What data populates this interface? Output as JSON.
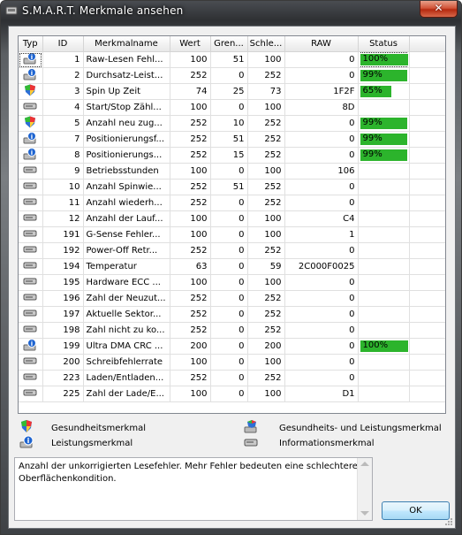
{
  "window": {
    "title": "S.M.A.R.T. Merkmale ansehen",
    "close_symbol": "✕"
  },
  "columns": [
    "Typ",
    "ID",
    "Merkmalname",
    "Wert",
    "Gren...",
    "Schle...",
    "RAW",
    "Status"
  ],
  "rows": [
    {
      "type": "performance",
      "id": "1",
      "name": "Raw-Lesen Fehl...",
      "wert": "100",
      "grenz": "51",
      "schlecht": "100",
      "raw": "0",
      "status": "100%",
      "pct": 100
    },
    {
      "type": "performance",
      "id": "2",
      "name": "Durchsatz-Leist...",
      "wert": "252",
      "grenz": "0",
      "schlecht": "252",
      "raw": "0",
      "status": "99%",
      "pct": 99
    },
    {
      "type": "health",
      "id": "3",
      "name": "Spin Up Zeit",
      "wert": "74",
      "grenz": "25",
      "schlecht": "73",
      "raw": "1F2F",
      "status": "65%",
      "pct": 65
    },
    {
      "type": "info",
      "id": "4",
      "name": "Start/Stop Zähl...",
      "wert": "100",
      "grenz": "0",
      "schlecht": "100",
      "raw": "8D",
      "status": "",
      "pct": 0
    },
    {
      "type": "health",
      "id": "5",
      "name": "Anzahl neu zug...",
      "wert": "252",
      "grenz": "10",
      "schlecht": "252",
      "raw": "0",
      "status": "99%",
      "pct": 99
    },
    {
      "type": "performance",
      "id": "7",
      "name": "Positionierungsf...",
      "wert": "252",
      "grenz": "51",
      "schlecht": "252",
      "raw": "0",
      "status": "99%",
      "pct": 99
    },
    {
      "type": "performance",
      "id": "8",
      "name": "Positionierungs...",
      "wert": "252",
      "grenz": "15",
      "schlecht": "252",
      "raw": "0",
      "status": "99%",
      "pct": 99
    },
    {
      "type": "info",
      "id": "9",
      "name": "Betriebsstunden",
      "wert": "100",
      "grenz": "0",
      "schlecht": "100",
      "raw": "106",
      "status": "",
      "pct": 0
    },
    {
      "type": "info",
      "id": "10",
      "name": "Anzahl Spinwie...",
      "wert": "252",
      "grenz": "51",
      "schlecht": "252",
      "raw": "0",
      "status": "",
      "pct": 0
    },
    {
      "type": "info",
      "id": "11",
      "name": "Anzahl wiederh...",
      "wert": "252",
      "grenz": "0",
      "schlecht": "252",
      "raw": "0",
      "status": "",
      "pct": 0
    },
    {
      "type": "info",
      "id": "12",
      "name": "Anzahl der Lauf...",
      "wert": "100",
      "grenz": "0",
      "schlecht": "100",
      "raw": "C4",
      "status": "",
      "pct": 0
    },
    {
      "type": "info",
      "id": "191",
      "name": "G-Sense Fehler...",
      "wert": "100",
      "grenz": "0",
      "schlecht": "100",
      "raw": "1",
      "status": "",
      "pct": 0
    },
    {
      "type": "info",
      "id": "192",
      "name": "Power-Off Retr...",
      "wert": "252",
      "grenz": "0",
      "schlecht": "252",
      "raw": "0",
      "status": "",
      "pct": 0
    },
    {
      "type": "info",
      "id": "194",
      "name": "Temperatur",
      "wert": "63",
      "grenz": "0",
      "schlecht": "59",
      "raw": "2C000F0025",
      "status": "",
      "pct": 0
    },
    {
      "type": "info",
      "id": "195",
      "name": "Hardware ECC ...",
      "wert": "100",
      "grenz": "0",
      "schlecht": "100",
      "raw": "0",
      "status": "",
      "pct": 0
    },
    {
      "type": "info",
      "id": "196",
      "name": "Zahl der Neuzut...",
      "wert": "252",
      "grenz": "0",
      "schlecht": "252",
      "raw": "0",
      "status": "",
      "pct": 0
    },
    {
      "type": "info",
      "id": "197",
      "name": "Aktuelle Sektor...",
      "wert": "252",
      "grenz": "0",
      "schlecht": "252",
      "raw": "0",
      "status": "",
      "pct": 0
    },
    {
      "type": "info",
      "id": "198",
      "name": "Zahl nicht zu ko...",
      "wert": "252",
      "grenz": "0",
      "schlecht": "252",
      "raw": "0",
      "status": "",
      "pct": 0
    },
    {
      "type": "performance",
      "id": "199",
      "name": "Ultra DMA CRC ...",
      "wert": "200",
      "grenz": "0",
      "schlecht": "200",
      "raw": "0",
      "status": "100%",
      "pct": 100
    },
    {
      "type": "info",
      "id": "200",
      "name": "Schreibfehlerrate",
      "wert": "100",
      "grenz": "0",
      "schlecht": "100",
      "raw": "0",
      "status": "",
      "pct": 0
    },
    {
      "type": "info",
      "id": "223",
      "name": "Laden/Entladen...",
      "wert": "252",
      "grenz": "0",
      "schlecht": "252",
      "raw": "0",
      "status": "",
      "pct": 0
    },
    {
      "type": "info",
      "id": "225",
      "name": "Zahl der Lade/E...",
      "wert": "100",
      "grenz": "0",
      "schlecht": "100",
      "raw": "D1",
      "status": "",
      "pct": 0
    }
  ],
  "legend": {
    "health": "Gesundheitsmerkmal",
    "health_performance": "Gesundheits- und Leistungsmerkmal",
    "performance": "Leistungsmerkmal",
    "info": "Informationsmerkmal"
  },
  "description": "Anzahl der unkorrigierten Lesefehler. Mehr Fehler bedeuten eine schlechtere Oberflächenkondition.",
  "ok_label": "OK",
  "colors": {
    "status_bar": "#2cb42c",
    "selection": "#ffffff"
  }
}
